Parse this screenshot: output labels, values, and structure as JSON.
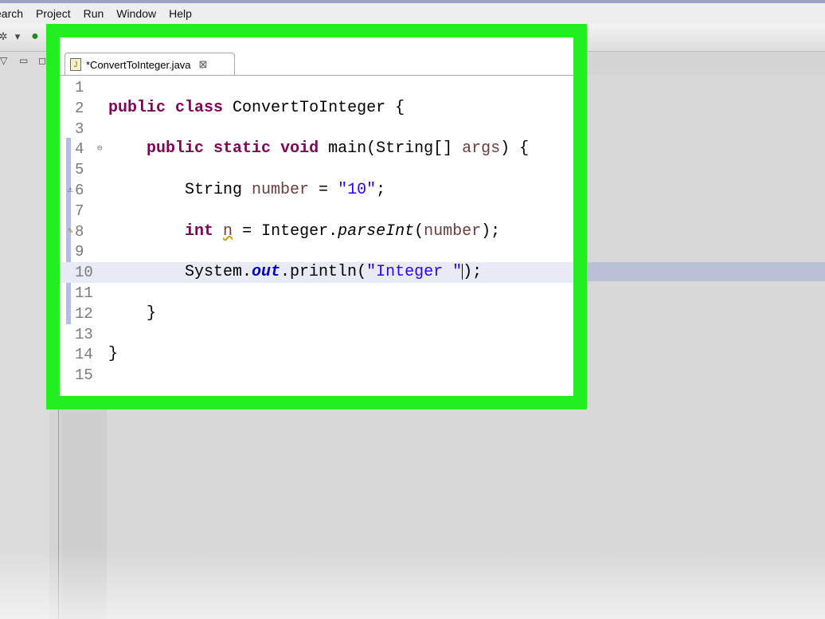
{
  "menu": [
    "earch",
    "Project",
    "Run",
    "Window",
    "Help"
  ],
  "toolbar_icons": [
    "gear-icon",
    "dropdown-icon",
    "run-icon",
    "debug-icon",
    "new-icon",
    "refresh-icon",
    "open-folder-icon",
    "open-type-icon",
    "search-icon",
    "back-icon",
    "forward-icon"
  ],
  "editor": {
    "tab_label": "*ConvertToInteger.java",
    "tab_close": "⊠",
    "current_line": 10
  },
  "code_lines": [
    {
      "n": "1",
      "segments": []
    },
    {
      "n": "2",
      "segments": [
        {
          "t": "public",
          "c": "kw"
        },
        {
          "t": " "
        },
        {
          "t": "class",
          "c": "kw"
        },
        {
          "t": " ConvertToInteger {"
        }
      ]
    },
    {
      "n": "3",
      "segments": []
    },
    {
      "n": "4",
      "segments": [
        {
          "t": "    "
        },
        {
          "t": "public",
          "c": "kw"
        },
        {
          "t": " "
        },
        {
          "t": "static",
          "c": "kw"
        },
        {
          "t": " "
        },
        {
          "t": "void",
          "c": "kw"
        },
        {
          "t": " main(String[] "
        },
        {
          "t": "args",
          "c": "var"
        },
        {
          "t": ") {"
        }
      ]
    },
    {
      "n": "5",
      "segments": []
    },
    {
      "n": "6",
      "segments": [
        {
          "t": "        String "
        },
        {
          "t": "number",
          "c": "var"
        },
        {
          "t": " = "
        },
        {
          "t": "\"10\"",
          "c": "str"
        },
        {
          "t": ";"
        }
      ]
    },
    {
      "n": "7",
      "segments": []
    },
    {
      "n": "8",
      "segments": [
        {
          "t": "        "
        },
        {
          "t": "int",
          "c": "kw"
        },
        {
          "t": " "
        },
        {
          "t": "n",
          "c": "var warnline"
        },
        {
          "t": " = Integer."
        },
        {
          "t": "parseInt",
          "c": "ital"
        },
        {
          "t": "("
        },
        {
          "t": "number",
          "c": "var"
        },
        {
          "t": ");"
        }
      ]
    },
    {
      "n": "9",
      "segments": []
    },
    {
      "n": "10",
      "segments": [
        {
          "t": "        System."
        },
        {
          "t": "out",
          "c": "field"
        },
        {
          "t": ".println("
        },
        {
          "t": "\"Integer \"",
          "c": "str"
        },
        {
          "t": "|caret|"
        },
        {
          "t": ");"
        }
      ]
    },
    {
      "n": "11",
      "segments": []
    },
    {
      "n": "12",
      "segments": [
        {
          "t": "    }"
        }
      ]
    },
    {
      "n": "13",
      "segments": []
    },
    {
      "n": "14",
      "segments": [
        {
          "t": "}"
        }
      ]
    },
    {
      "n": "15",
      "segments": []
    }
  ],
  "annotations": {
    "fold_line": "4",
    "fold_icon": "⊖",
    "warning_line": "6",
    "warning_icon": "⚠",
    "quickfix_line": "8",
    "quickfix_icon": "✎"
  },
  "colors": {
    "highlight_frame": "#22ee22",
    "keyword": "#7f0055",
    "string": "#2a00ff",
    "local_variable": "#6a3e3e",
    "static_field": "#0000c0",
    "current_line": "#e8eaf6"
  }
}
